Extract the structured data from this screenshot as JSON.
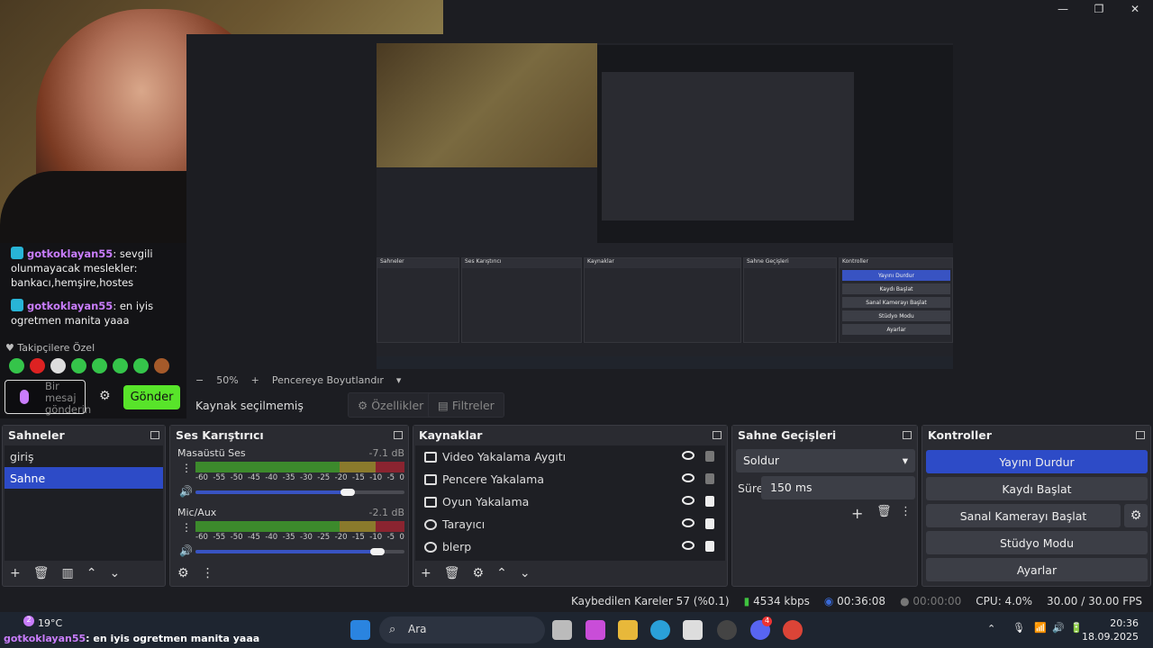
{
  "window": {
    "minimize": "—",
    "restore": "❐",
    "close": "✕"
  },
  "chat": {
    "messages": [
      {
        "user": "gotkoklayan55",
        "text": ": sevgili olunmayacak meslekler: bankacı,hemşire,hostes"
      },
      {
        "user": "gotkoklayan55",
        "text": ": en iyis ogretmen manita yaaa"
      }
    ],
    "followers_label": "Takipçilere Özel",
    "input_placeholder": "Bir mesaj gönderin",
    "send_label": "Gönder"
  },
  "preview": {
    "zoom": "50%",
    "fit_label": "Pencereye Boyutlandır"
  },
  "source_toolbar": {
    "no_source": "Kaynak seçilmemiş",
    "properties": "Özellikler",
    "filters": "Filtreler"
  },
  "scenes": {
    "title": "Sahneler",
    "items": [
      {
        "label": "giriş",
        "selected": false
      },
      {
        "label": "Sahne",
        "selected": true
      }
    ]
  },
  "mixer": {
    "title": "Ses Karıştırıcı",
    "channels": [
      {
        "name": "Masaüstü Ses",
        "db": "-7.1 dB",
        "volume": 0.73
      },
      {
        "name": "Mic/Aux",
        "db": "-2.1 dB",
        "volume": 0.87
      }
    ],
    "ticks": [
      "-60",
      "-55",
      "-50",
      "-45",
      "-40",
      "-35",
      "-30",
      "-25",
      "-20",
      "-15",
      "-10",
      "-5",
      "0"
    ]
  },
  "sources": {
    "title": "Kaynaklar",
    "items": [
      {
        "label": "Video Yakalama Aygıtı",
        "locked": false
      },
      {
        "label": "Pencere Yakalama",
        "locked": false
      },
      {
        "label": "Oyun Yakalama",
        "locked": true
      },
      {
        "label": "Tarayıcı",
        "locked": true
      },
      {
        "label": "blerp",
        "locked": true
      }
    ]
  },
  "transitions": {
    "title": "Sahne Geçişleri",
    "selected": "Soldur",
    "duration_label": "Süre",
    "duration": "150 ms"
  },
  "controls": {
    "title": "Kontroller",
    "stop_stream": "Yayını Durdur",
    "start_record": "Kaydı Başlat",
    "virtual_cam": "Sanal Kamerayı Başlat",
    "studio_mode": "Stüdyo Modu",
    "settings": "Ayarlar"
  },
  "status": {
    "dropped": "Kaybedilen Kareler 57 (%0.1)",
    "bitrate": "4534 kbps",
    "stream_time": "00:36:08",
    "record_time": "00:00:00",
    "cpu": "CPU: 4.0%",
    "fps": "30.00 / 30.00 FPS"
  },
  "taskbar": {
    "weather": "19°C",
    "weather_badge": "2",
    "chatline_user": "gotkoklayan55",
    "chatline_text": ": en iyis ogretmen manita yaaa",
    "search": "Ara",
    "discord_badge": "4",
    "time": "20:36",
    "date": "18.09.2025"
  },
  "colors": {
    "accent_blue": "#2d4bc7",
    "send_green": "#58e42a",
    "username_purple": "#c97dfc"
  }
}
